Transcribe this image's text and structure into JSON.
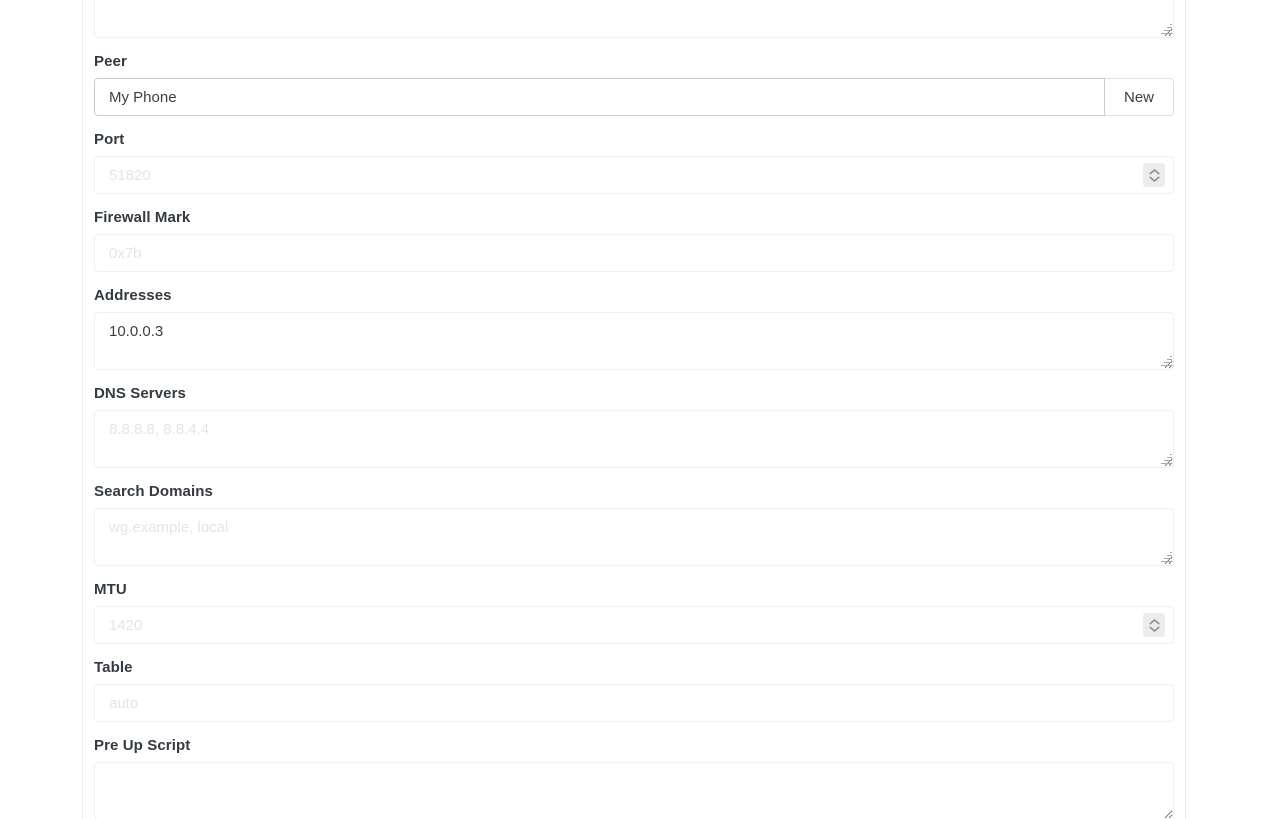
{
  "panel": {
    "accent_border_color": "#e9ecef",
    "input_border_color": "#f0f0f2",
    "filled_input_border_color": "#c9ccd1",
    "label_color": "#343a40",
    "value_color": "#3a3f44",
    "placeholder_color": "#e4e5e8"
  },
  "fields": {
    "top_textarea": {
      "value": "",
      "placeholder": ""
    },
    "peer": {
      "label": "Peer",
      "value": "My Phone",
      "placeholder": "",
      "button_label": "New"
    },
    "port": {
      "label": "Port",
      "value": "",
      "placeholder": "51820",
      "spinner_icon": "chevron-up-down-icon"
    },
    "firewall_mark": {
      "label": "Firewall Mark",
      "value": "",
      "placeholder": "0x7b"
    },
    "addresses": {
      "label": "Addresses",
      "value": "10.0.0.3",
      "placeholder": ""
    },
    "dns_servers": {
      "label": "DNS Servers",
      "value": "",
      "placeholder": "8.8.8.8, 8.8.4.4"
    },
    "search_domains": {
      "label": "Search Domains",
      "value": "",
      "placeholder": "wg.example, local"
    },
    "mtu": {
      "label": "MTU",
      "value": "",
      "placeholder": "1420",
      "spinner_icon": "chevron-up-down-icon"
    },
    "table": {
      "label": "Table",
      "value": "",
      "placeholder": "auto"
    },
    "pre_up_script": {
      "label": "Pre Up Script",
      "value": "",
      "placeholder": ""
    }
  }
}
